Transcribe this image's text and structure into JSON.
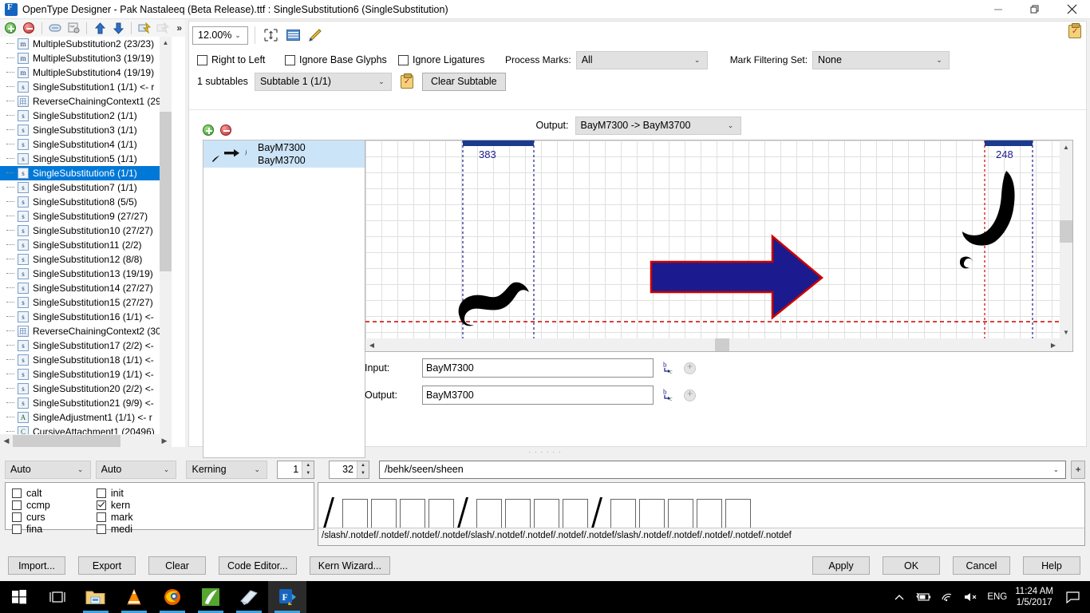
{
  "window": {
    "title": "OpenType Designer - Pak Nastaleeq (Beta Release).ttf : SingleSubstitution6 (SingleSubstitution)",
    "app_icon": "font-designer-icon",
    "minimize": "–",
    "maximize": "❐",
    "close": "✕"
  },
  "tree_toolbar": {
    "add": "add-icon",
    "remove": "remove-icon",
    "rename": "rename-icon",
    "properties": "properties-icon",
    "move_up": "arrow-up-icon",
    "move_down": "arrow-down-icon",
    "compile": "compile-icon",
    "compile_all": "compile-all-icon",
    "overflow": "»"
  },
  "tree": {
    "items": [
      {
        "label": "MultipleSubstitution2 (23/23)",
        "icon": "m",
        "kind": "m",
        "selected": false
      },
      {
        "label": "MultipleSubstitution3 (19/19)",
        "icon": "m",
        "kind": "m",
        "selected": false
      },
      {
        "label": "MultipleSubstitution4 (19/19)",
        "icon": "m",
        "kind": "m",
        "selected": false
      },
      {
        "label": "SingleSubstitution1 (1/1) <- r",
        "icon": "s",
        "kind": "s",
        "selected": false
      },
      {
        "label": "ReverseChainingContext1 (29",
        "icon": "rc",
        "kind": "rc",
        "selected": false
      },
      {
        "label": "SingleSubstitution2 (1/1)",
        "icon": "s",
        "kind": "s",
        "selected": false
      },
      {
        "label": "SingleSubstitution3 (1/1)",
        "icon": "s",
        "kind": "s",
        "selected": false
      },
      {
        "label": "SingleSubstitution4 (1/1)",
        "icon": "s",
        "kind": "s",
        "selected": false
      },
      {
        "label": "SingleSubstitution5 (1/1)",
        "icon": "s",
        "kind": "s",
        "selected": false
      },
      {
        "label": "SingleSubstitution6 (1/1)",
        "icon": "s",
        "kind": "s",
        "selected": true
      },
      {
        "label": "SingleSubstitution7 (1/1)",
        "icon": "s",
        "kind": "s",
        "selected": false
      },
      {
        "label": "SingleSubstitution8 (5/5)",
        "icon": "s",
        "kind": "s",
        "selected": false
      },
      {
        "label": "SingleSubstitution9 (27/27)",
        "icon": "s",
        "kind": "s",
        "selected": false
      },
      {
        "label": "SingleSubstitution10 (27/27)",
        "icon": "s",
        "kind": "s",
        "selected": false
      },
      {
        "label": "SingleSubstitution11 (2/2)",
        "icon": "s",
        "kind": "s",
        "selected": false
      },
      {
        "label": "SingleSubstitution12 (8/8)",
        "icon": "s",
        "kind": "s",
        "selected": false
      },
      {
        "label": "SingleSubstitution13 (19/19)",
        "icon": "s",
        "kind": "s",
        "selected": false
      },
      {
        "label": "SingleSubstitution14 (27/27)",
        "icon": "s",
        "kind": "s",
        "selected": false
      },
      {
        "label": "SingleSubstitution15 (27/27)",
        "icon": "s",
        "kind": "s",
        "selected": false
      },
      {
        "label": "SingleSubstitution16 (1/1) <- ",
        "icon": "s",
        "kind": "s",
        "selected": false
      },
      {
        "label": "ReverseChainingContext2 (30",
        "icon": "rc",
        "kind": "rc",
        "selected": false
      },
      {
        "label": "SingleSubstitution17 (2/2) <- ",
        "icon": "s",
        "kind": "s",
        "selected": false
      },
      {
        "label": "SingleSubstitution18 (1/1) <- ",
        "icon": "s",
        "kind": "s",
        "selected": false
      },
      {
        "label": "SingleSubstitution19 (1/1) <- ",
        "icon": "s",
        "kind": "s",
        "selected": false
      },
      {
        "label": "SingleSubstitution20 (2/2) <- ",
        "icon": "s",
        "kind": "s",
        "selected": false
      },
      {
        "label": "SingleSubstitution21 (9/9) <- ",
        "icon": "s",
        "kind": "s",
        "selected": false
      },
      {
        "label": "SingleAdjustment1 (1/1) <- r",
        "icon": "A",
        "kind": "adj",
        "selected": false
      },
      {
        "label": "CursiveAttachment1 (20496)",
        "icon": "C",
        "kind": "cur",
        "selected": false
      }
    ]
  },
  "toolbar": {
    "zoom_value": "12.00%",
    "fit_icon": "fit-to-window-icon",
    "table_icon": "table-view-icon",
    "pen_icon": "edit-pen-icon",
    "clipboard_icon": "clipboard-check-icon"
  },
  "options": {
    "right_to_left": {
      "label": "Right to Left",
      "checked": false
    },
    "ignore_base_glyphs": {
      "label": "Ignore Base Glyphs",
      "checked": false
    },
    "ignore_ligatures": {
      "label": "Ignore Ligatures",
      "checked": false
    },
    "process_marks_label": "Process Marks:",
    "process_marks_value": "All",
    "mark_filtering_label": "Mark Filtering Set:",
    "mark_filtering_value": "None"
  },
  "subtable": {
    "count_label": "1 subtables",
    "selected": "Subtable 1 (1/1)",
    "clear_button": "Clear Subtable"
  },
  "output": {
    "label": "Output:",
    "value": "BayM7300 -> BayM3700"
  },
  "pair_list": {
    "add_icon": "add-pair-icon",
    "remove_icon": "remove-pair-icon",
    "items": [
      {
        "input": "BayM7300",
        "output": "BayM3700"
      }
    ]
  },
  "canvas": {
    "input_advance": "383",
    "output_advance": "248",
    "arrow_fill": "#1b1b8f",
    "arrow_stroke": "#cc0000",
    "baseline_color": "#cc0000",
    "metric_color": "#1b1b8f",
    "grid_color": "#e0e0e0"
  },
  "fields": {
    "input_label": "Input:",
    "input_value": "BayM7300",
    "output_label": "Output:",
    "output_value": "BayM3700",
    "pick_glyph_icon": "glyph-picker-icon",
    "add_icon": "add-circle-icon"
  },
  "bottom_controls": {
    "script": "Auto",
    "language": "Auto",
    "feature": "Kerning",
    "number1": "1",
    "number2": "32",
    "text_value": "/behk/seen/sheen",
    "add_button": "+"
  },
  "features": {
    "column1": [
      {
        "tag": "calt",
        "checked": false
      },
      {
        "tag": "ccmp",
        "checked": false
      },
      {
        "tag": "curs",
        "checked": false
      },
      {
        "tag": "fina",
        "checked": false
      }
    ],
    "column2": [
      {
        "tag": "init",
        "checked": false
      },
      {
        "tag": "kern",
        "checked": true
      },
      {
        "tag": "mark",
        "checked": false
      },
      {
        "tag": "medi",
        "checked": false
      }
    ]
  },
  "preview": {
    "status_text": "/slash/.notdef/.notdef/.notdef/.notdef/slash/.notdef/.notdef/.notdef/.notdef/slash/.notdef/.notdef/.notdef/.notdef/.notdef",
    "glyph_cells": [
      "slash",
      "box",
      "box",
      "box",
      "box",
      "slash",
      "box",
      "box",
      "box",
      "box",
      "slash",
      "box",
      "box",
      "box",
      "box",
      "box"
    ]
  },
  "dialog_buttons": {
    "import": "Import...",
    "export": "Export",
    "clear": "Clear",
    "code_editor": "Code Editor...",
    "kern_wizard": "Kern Wizard...",
    "apply": "Apply",
    "ok": "OK",
    "cancel": "Cancel",
    "help": "Help"
  },
  "taskbar": {
    "start": "start-button-icon",
    "task_view": "task-view-icon",
    "items": [
      {
        "name": "file-explorer-icon"
      },
      {
        "name": "vlc-media-player-icon"
      },
      {
        "name": "firefox-icon"
      },
      {
        "name": "kde-app-icon"
      },
      {
        "name": "sticky-notes-icon"
      },
      {
        "name": "font-designer-icon"
      }
    ],
    "tray": {
      "show_hidden": "chevron-up-icon",
      "battery": "battery-charging-icon",
      "network": "wifi-icon",
      "volume": "volume-muted-icon",
      "language": "ENG",
      "time": "11:24 AM",
      "date": "1/5/2017",
      "action_center": "action-center-icon"
    }
  }
}
